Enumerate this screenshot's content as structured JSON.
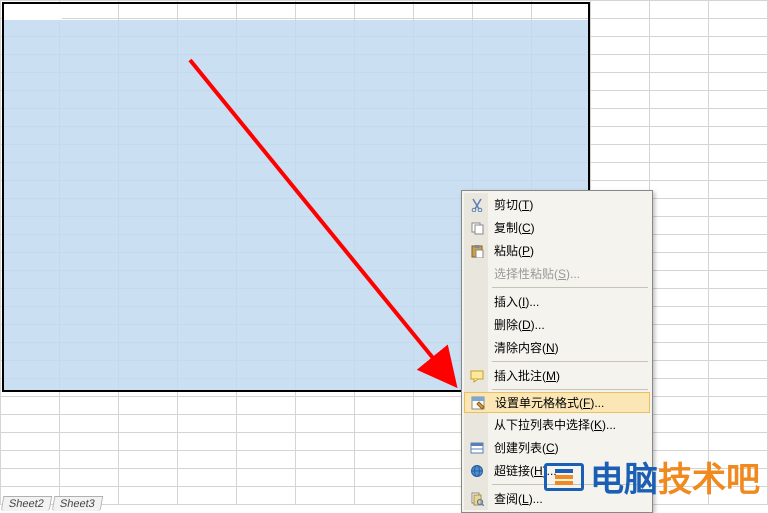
{
  "menu": {
    "cut": "剪切(T)",
    "copy": "复制(C)",
    "paste": "粘贴(P)",
    "paste_special": "选择性粘贴(S)...",
    "insert": "插入(I)...",
    "delete": "删除(D)...",
    "clear": "清除内容(N)",
    "insert_comment": "插入批注(M)",
    "format_cells": "设置单元格格式(F)...",
    "pick_list": "从下拉列表中选择(K)...",
    "create_list": "创建列表(C)",
    "hyperlink": "超链接(H)...",
    "lookup": "查阅(L)..."
  },
  "tabs": {
    "sheet2": "Sheet2",
    "sheet3": "Sheet3"
  },
  "watermark": {
    "part1": "电脑",
    "part2": "技术吧"
  },
  "icons": {
    "cut": "cut-icon",
    "copy": "copy-icon",
    "paste": "paste-icon",
    "comment": "comment-icon",
    "format": "format-cells-icon",
    "list": "list-icon",
    "link": "hyperlink-icon",
    "lookup": "lookup-icon"
  }
}
